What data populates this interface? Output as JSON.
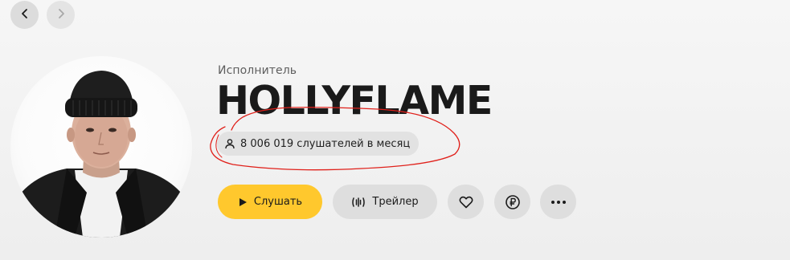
{
  "navigation": {
    "back_icon": "chevron-left-icon",
    "forward_icon": "chevron-right-icon"
  },
  "artist": {
    "role_label": "Исполнитель",
    "name": "HOLLYFLAME",
    "listeners_text": "8 006 019 слушателей в месяц",
    "listeners_icon": "user-icon"
  },
  "actions": {
    "play_label": "Слушать",
    "play_icon": "play-icon",
    "trailer_label": "Трейлер",
    "trailer_icon": "waveform-icon",
    "like_icon": "heart-icon",
    "donate_icon": "ruble-coin-icon",
    "more_icon": "more-dots-icon"
  },
  "colors": {
    "accent": "#ffc82d",
    "annotation": "#e0201a",
    "button_bg": "#dedede"
  }
}
